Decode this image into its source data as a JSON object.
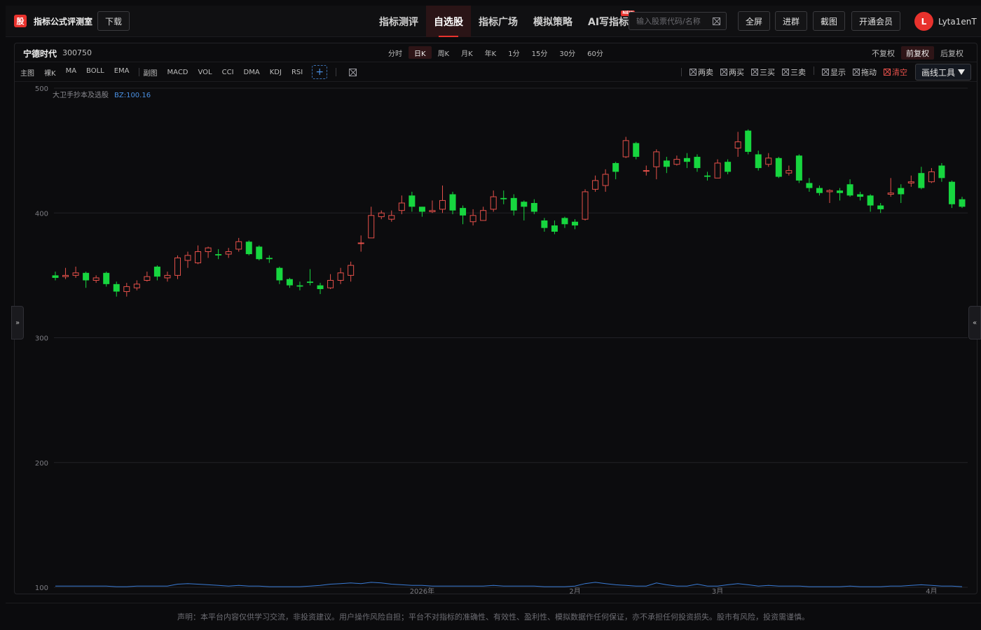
{
  "app": {
    "logo_char": "股",
    "title": "指标公式评测室",
    "download_label": "下载"
  },
  "nav": {
    "items": [
      {
        "label": "指标测评"
      },
      {
        "label": "自选股"
      },
      {
        "label": "指标广场"
      },
      {
        "label": "模拟策略"
      },
      {
        "label": "AI写指标",
        "badge": "NEW"
      }
    ],
    "active_index": 1
  },
  "search": {
    "placeholder": "输入股票代码/名称"
  },
  "toolbar": {
    "fullscreen_label": "全屏",
    "join_group_label": "进群",
    "screenshot_label": "截图",
    "vip_label": "开通会员"
  },
  "user": {
    "avatar_initial": "L",
    "name": "Lyta1enT"
  },
  "stock": {
    "name": "宁德时代",
    "code": "300750"
  },
  "periods": [
    "分时",
    "日K",
    "周K",
    "月K",
    "年K",
    "1分",
    "15分",
    "30分",
    "60分"
  ],
  "active_period_index": 1,
  "adjust": [
    "不复权",
    "前复权",
    "后复权"
  ],
  "active_adjust_index": 1,
  "indicators": {
    "main_label": "主图",
    "main": [
      "裸K",
      "MA",
      "BOLL",
      "EMA"
    ],
    "sub_label": "副图",
    "sub": [
      "MACD",
      "VOL",
      "CCI",
      "DMA",
      "KDJ",
      "RSI"
    ],
    "add_symbol": "+"
  },
  "signal_tools": [
    "两卖",
    "两买",
    "三买",
    "三卖",
    "显示",
    "拖动",
    "清空"
  ],
  "draw_tools_label": "画线工具",
  "side_tabs": {
    "left": "»",
    "right": "«"
  },
  "colors": {
    "up": "#e5504a",
    "down": "#17d63f",
    "accent": "#e8322d",
    "line": "#3a7bd5"
  },
  "chart_data": {
    "type": "candlestick",
    "indicator_label": "大卫手抄本及选股",
    "indicator_value_label": "BZ:100.16",
    "y_ticks": [
      500,
      400,
      300,
      200,
      100
    ],
    "ylim": [
      100,
      500
    ],
    "x_labels": [
      {
        "text": "2026年",
        "index": 36
      },
      {
        "text": "2月",
        "index": 51
      },
      {
        "text": "3月",
        "index": 65
      },
      {
        "text": "4月",
        "index": 86
      }
    ],
    "candles": [
      [
        350,
        348,
        353,
        346
      ],
      [
        349,
        350,
        356,
        347
      ],
      [
        350,
        352,
        357,
        348
      ],
      [
        352,
        346,
        353,
        340
      ],
      [
        346,
        348,
        350,
        344
      ],
      [
        352,
        343,
        353,
        341
      ],
      [
        343,
        337,
        345,
        333
      ],
      [
        337,
        341,
        344,
        333
      ],
      [
        340,
        343,
        346,
        338
      ],
      [
        346,
        349,
        353,
        345
      ],
      [
        357,
        349,
        358,
        346
      ],
      [
        348,
        350,
        353,
        345
      ],
      [
        350,
        364,
        366,
        347
      ],
      [
        362,
        366,
        369,
        356
      ],
      [
        360,
        369,
        374,
        359
      ],
      [
        369,
        372,
        373,
        364
      ],
      [
        367,
        366,
        371,
        363
      ],
      [
        367,
        369,
        372,
        364
      ],
      [
        371,
        377,
        380,
        369
      ],
      [
        377,
        367,
        378,
        366
      ],
      [
        373,
        363,
        374,
        362
      ],
      [
        364,
        363,
        366,
        360
      ],
      [
        356,
        346,
        357,
        343
      ],
      [
        347,
        342,
        348,
        340
      ],
      [
        342,
        341,
        345,
        338
      ],
      [
        345,
        344,
        355,
        342
      ],
      [
        342,
        339,
        344,
        335
      ],
      [
        340,
        346,
        351,
        339
      ],
      [
        346,
        352,
        356,
        343
      ],
      [
        350,
        358,
        361,
        345
      ],
      [
        376,
        376,
        382,
        369
      ],
      [
        380,
        398,
        405,
        380
      ],
      [
        397,
        400,
        402,
        395
      ],
      [
        395,
        398,
        402,
        393
      ],
      [
        402,
        408,
        414,
        399
      ],
      [
        414,
        405,
        417,
        401
      ],
      [
        405,
        401,
        405,
        397
      ],
      [
        401,
        402,
        410,
        400
      ],
      [
        403,
        410,
        422,
        400
      ],
      [
        415,
        402,
        417,
        399
      ],
      [
        404,
        398,
        406,
        391
      ],
      [
        393,
        398,
        403,
        390
      ],
      [
        394,
        402,
        405,
        394
      ],
      [
        403,
        413,
        418,
        401
      ],
      [
        412,
        411,
        418,
        407
      ],
      [
        412,
        402,
        415,
        398
      ],
      [
        409,
        405,
        410,
        394
      ],
      [
        408,
        401,
        411,
        399
      ],
      [
        394,
        388,
        396,
        385
      ],
      [
        390,
        385,
        394,
        383
      ],
      [
        396,
        391,
        397,
        388
      ],
      [
        393,
        390,
        395,
        387
      ],
      [
        395,
        417,
        419,
        394
      ],
      [
        419,
        426,
        430,
        417
      ],
      [
        422,
        431,
        435,
        417
      ],
      [
        440,
        433,
        441,
        427
      ],
      [
        445,
        458,
        461,
        444
      ],
      [
        456,
        445,
        457,
        443
      ],
      [
        434,
        434,
        438,
        430
      ],
      [
        437,
        449,
        451,
        427
      ],
      [
        442,
        437,
        445,
        432
      ],
      [
        439,
        443,
        446,
        438
      ],
      [
        444,
        441,
        448,
        436
      ],
      [
        445,
        436,
        447,
        433
      ],
      [
        430,
        429,
        433,
        426
      ],
      [
        428,
        440,
        443,
        428
      ],
      [
        441,
        433,
        443,
        431
      ],
      [
        452,
        457,
        465,
        445
      ],
      [
        466,
        449,
        467,
        447
      ],
      [
        447,
        436,
        450,
        434
      ],
      [
        439,
        444,
        448,
        437
      ],
      [
        444,
        429,
        445,
        428
      ],
      [
        432,
        434,
        438,
        430
      ],
      [
        446,
        426,
        447,
        424
      ],
      [
        424,
        420,
        428,
        417
      ],
      [
        420,
        416,
        422,
        414
      ],
      [
        417,
        418,
        419,
        408
      ],
      [
        418,
        416,
        420,
        410
      ],
      [
        423,
        414,
        427,
        413
      ],
      [
        415,
        413,
        417,
        410
      ],
      [
        414,
        406,
        415,
        401
      ],
      [
        406,
        403,
        408,
        400
      ],
      [
        415,
        416,
        428,
        413
      ],
      [
        420,
        415,
        423,
        408
      ],
      [
        424,
        425,
        430,
        421
      ],
      [
        432,
        420,
        437,
        419
      ],
      [
        425,
        433,
        436,
        424
      ],
      [
        438,
        428,
        440,
        425
      ],
      [
        425,
        407,
        426,
        404
      ],
      [
        411,
        405,
        413,
        404
      ]
    ],
    "indicator_line": [
      101,
      101,
      101,
      101,
      101,
      101,
      100.5,
      100.5,
      101,
      101,
      101,
      101,
      102.5,
      103,
      102.5,
      102,
      101.5,
      101,
      101.5,
      101,
      101,
      100.5,
      100.5,
      100.5,
      100.5,
      101,
      101.5,
      102.5,
      103,
      103.5,
      103,
      104,
      103.5,
      102.5,
      102,
      101.5,
      101.5,
      101,
      101,
      101,
      101,
      101,
      101,
      101.5,
      101,
      101,
      101,
      101,
      100.5,
      100.5,
      100.5,
      101,
      103,
      104,
      103,
      102,
      101.5,
      101,
      101,
      103.5,
      102,
      101,
      101,
      102.5,
      101,
      101,
      102,
      103,
      102,
      101,
      101.5,
      101,
      101,
      101,
      100.5,
      100.5,
      100.5,
      100.5,
      101,
      100.5,
      100.5,
      100.5,
      101,
      101,
      101.5,
      102,
      101.5,
      101,
      101,
      100.5
    ]
  },
  "footer": {
    "disclaimer": "声明：本平台内容仅供学习交流，非投资建议。用户操作风险自担；平台不对指标的准确性、有效性、盈利性、模拟数据作任何保证，亦不承担任何投资损失。股市有风险，投资需谨慎。"
  }
}
